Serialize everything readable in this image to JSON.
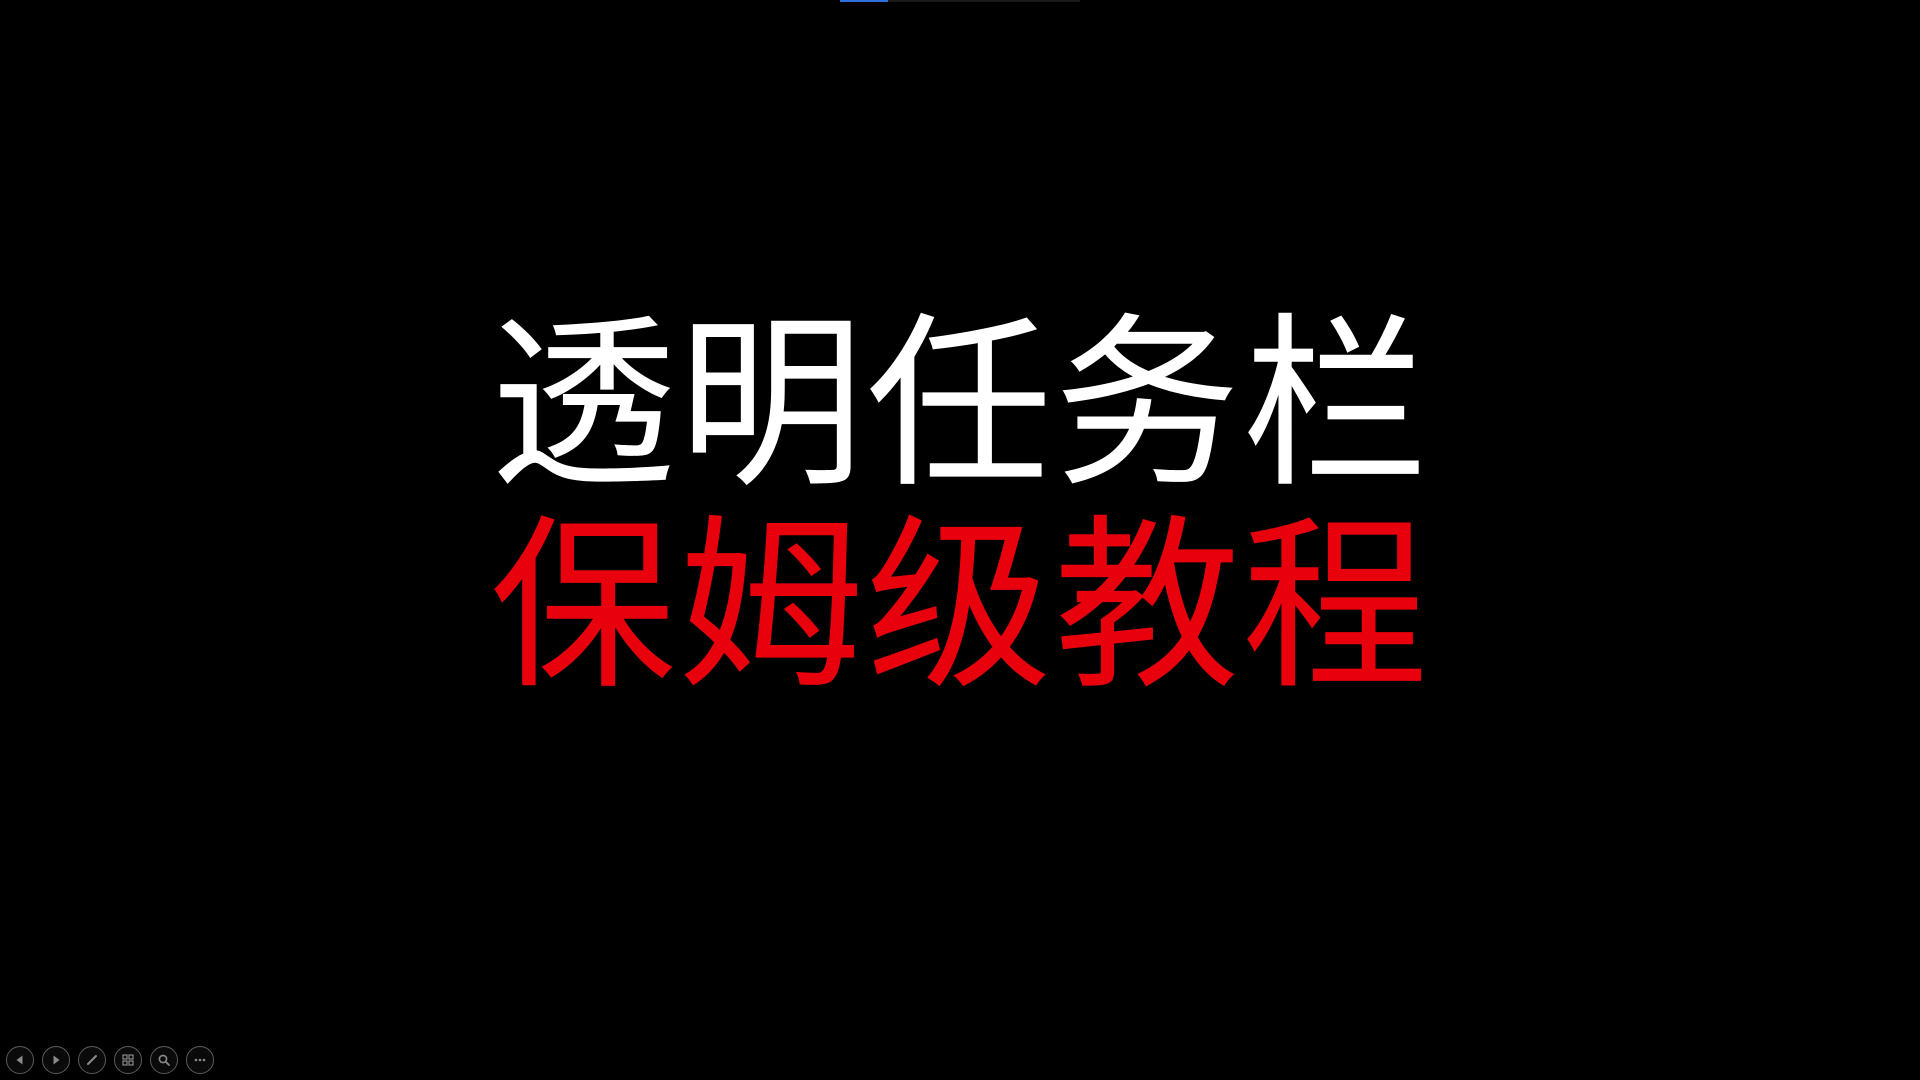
{
  "slide": {
    "title_line_1": "透明任务栏",
    "title_line_2": "保姆级教程",
    "colors": {
      "background": "#000000",
      "line_1": "#ffffff",
      "line_2": "#e8000c",
      "progress_accent": "#2f6fe0"
    },
    "progress": 0.2
  },
  "controls": {
    "items": [
      {
        "icon": "previous-icon"
      },
      {
        "icon": "next-icon"
      },
      {
        "icon": "pen-icon"
      },
      {
        "icon": "slide-grid-icon"
      },
      {
        "icon": "zoom-icon"
      },
      {
        "icon": "more-icon"
      }
    ]
  }
}
